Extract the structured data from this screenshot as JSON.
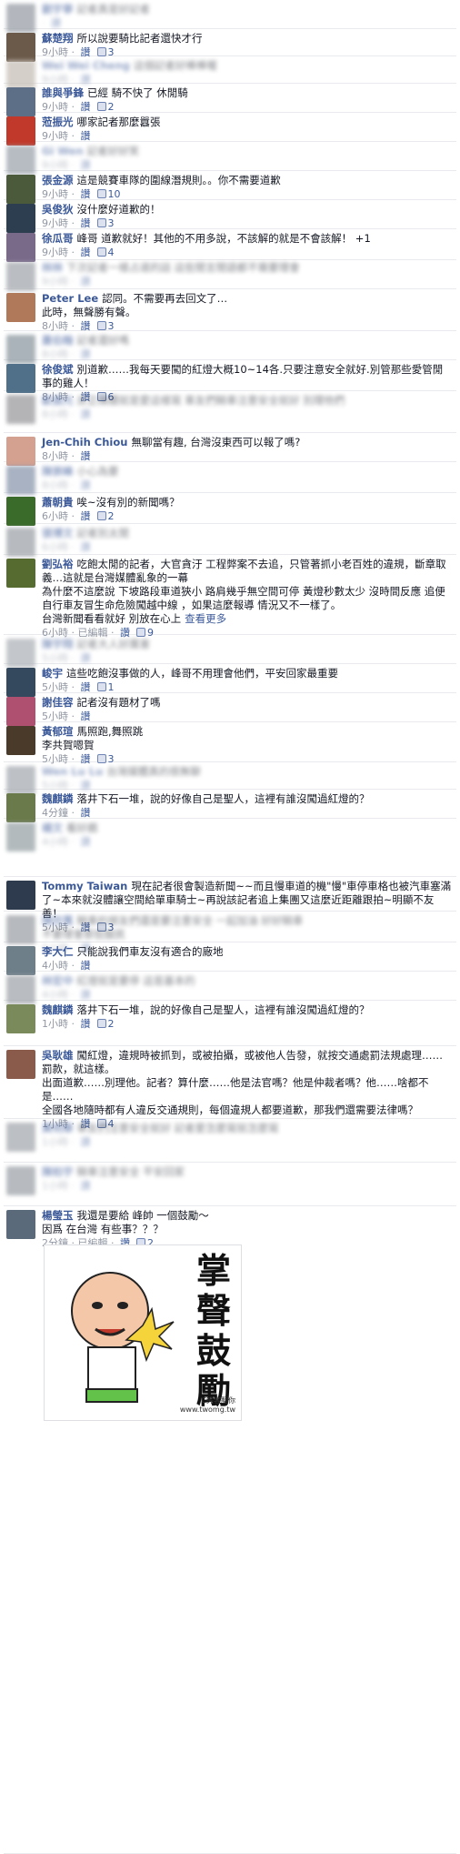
{
  "labels": {
    "reply": "讚",
    "edited": "已編輯",
    "see_more": "查看更多"
  },
  "colors": {
    "link": "#3b5998",
    "meta": "#9197a3",
    "divider": "#e9eaed"
  },
  "comments": [
    {
      "blur": true,
      "name": "劉宇寧",
      "text": "記者真是好記者",
      "time": "",
      "likes": ""
    },
    {
      "blur": false,
      "name": "蘇楚翔",
      "text": "所以說要騎比記者還快才行",
      "time": "9小時",
      "likes": "3"
    },
    {
      "blur": true,
      "name": "Wei Wei Cheng",
      "text": "這個記者好棒棒喔",
      "time": "9小時",
      "likes": ""
    },
    {
      "blur": false,
      "name": "誰與爭鋒",
      "text": "已經 騎不快了 休閒騎",
      "time": "9小時",
      "likes": "2"
    },
    {
      "blur": false,
      "name": "蒞振光",
      "text": "哪家記者那麼囂張",
      "time": "9小時",
      "likes": ""
    },
    {
      "blur": true,
      "name": "Gi Wen",
      "text": "記者好好笑",
      "time": "9小時",
      "likes": ""
    },
    {
      "blur": false,
      "name": "張金源",
      "text": "這是競賽車隊的圍線潛規則。。你不需要道歉",
      "time": "9小時",
      "likes": "10"
    },
    {
      "blur": false,
      "name": "吳俊狄",
      "text": "沒什麼好道歉的！",
      "time": "9小時",
      "likes": "3"
    },
    {
      "blur": false,
      "name": "徐瓜哥",
      "text": "峰哥 道歉就好！其他的不用多說，不該解的就是不會該解！ +1",
      "time": "9小時",
      "likes": "4"
    },
    {
      "blur": true,
      "name": "林林",
      "text": "下次記者一樣占道的話 這些閒言閒語都不需要理會",
      "time": "9小時",
      "likes": ""
    },
    {
      "blur": false,
      "name": "Peter Lee",
      "text": "認同。不需要再去回文了…\n此時，無聲勝有聲。",
      "time": "8小時",
      "likes": "3"
    },
    {
      "blur": true,
      "name": "蕭伯翰",
      "text": "記者還好嗎",
      "time": "8小時",
      "likes": ""
    },
    {
      "blur": false,
      "name": "徐俊斌",
      "text": "別道歉……我每天要闖的紅燈大概10~14各.只要注意安全就好.別管那些愛管閒事的雞人！",
      "time": "8小時",
      "likes": "6"
    },
    {
      "blur": true,
      "name": "歐振光",
      "text": "反正媒體就是愛這樣寫 車友們騎車注意安全就好 別理他們",
      "time": "8小時",
      "likes": ""
    },
    {
      "blur": false,
      "name": "Jen-Chih Chiou",
      "text": "無聊當有趣, 台灣沒東西可以報了嗎?",
      "time": "8小時",
      "likes": ""
    },
    {
      "blur": true,
      "name": "陳崇峰",
      "text": "小心為要",
      "time": "8小時",
      "likes": ""
    },
    {
      "blur": false,
      "name": "蕭朝貴",
      "text": "唉~沒有別的新聞嗎？",
      "time": "6小時",
      "likes": "2"
    },
    {
      "blur": true,
      "name": "張博文",
      "text": "記者別太閒",
      "time": "6小時",
      "likes": ""
    },
    {
      "blur": false,
      "name": "劉弘裕",
      "text": "吃飽太閒的記者，大官貪汙 工程弊案不去追，只管著抓小老百姓的違規，斷章取義…這就是台灣媒體亂象的一幕\n為什麼不這麼說 下坡路段車道狹小 路肩幾乎無空間可停 黃燈秒數太少 沒時間反應 追便自行車友冒生命危險闖越中線 ，如果這麼報導 情況又不一樣了。\n台灣新聞看看就好 別放在心上",
      "time": "6小時",
      "likes": "9",
      "edited": true,
      "more": true
    },
    {
      "blur": true,
      "name": "陳宇翔",
      "text": "記者大人好厲害",
      "time": "5小時",
      "likes": ""
    },
    {
      "blur": false,
      "name": "峻宇",
      "text": "這些吃飽沒事做的人，峰哥不用理會他們，平安回家最重要",
      "time": "5小時",
      "likes": "1"
    },
    {
      "blur": false,
      "name": "謝佳容",
      "text": "記者沒有題材了嗎",
      "time": "5小時",
      "likes": ""
    },
    {
      "blur": false,
      "name": "黃郁瑄",
      "text": "馬照跑,舞照跳\n李共賀嗯賀",
      "time": "5小時",
      "likes": "3"
    },
    {
      "blur": true,
      "name": "Wen Lu Lu",
      "text": "台灣媒體真的很無聊",
      "time": "5小時",
      "likes": ""
    },
    {
      "blur": false,
      "name": "魏麒鏻",
      "text": "落井下石一堆，說的好像自己是聖人，這裡有誰沒闖過紅燈的？",
      "time": "4分鐘",
      "likes": ""
    },
    {
      "blur": true,
      "name": "楊文",
      "text": "看好戲",
      "time": "4小時",
      "likes": ""
    },
    {
      "blur": false,
      "name": "Tommy Taiwan",
      "text": "現在記者很會製造新聞~~而且慢車道的機\"慢\"車停車格也被汽車塞滿了~本來就沒體讓空間給單車騎士~再說該記者追上集團又這麼近距離跟拍~明顯不友善！",
      "time": "5小時",
      "likes": "3"
    },
    {
      "blur": true,
      "name": "陳欣萬",
      "text": "騎車的朋友們還是要注意安全 一起加油 好好騎車\n不要理會那些酸民",
      "time": "5小時",
      "likes": ""
    },
    {
      "blur": false,
      "name": "李大仁",
      "text": "只能說我們車友沒有適合的廠地",
      "time": "4小時",
      "likes": ""
    },
    {
      "blur": true,
      "name": "林宏中",
      "text": "紅燈就是要停 這是基本的",
      "time": "4小時",
      "likes": ""
    },
    {
      "blur": false,
      "name": "魏麒鏻",
      "text": "落井下石一堆，說的好像自己是聖人，這裡有誰沒闖過紅燈的？",
      "time": "1小時",
      "likes": "2"
    },
    {
      "blur": false,
      "name": "吳耿雄",
      "text": "闖紅燈，違規時被抓到，或被拍攝，或被他人告發，就按交通處罰法規處理……罰款，就這樣。\n出面道歉……別理他。記者？算什麼……他是法官嗎？他是仲裁者嗎？他……啥都不是……\n全國各地隨時都有人違反交通規則，每個違規人都要道歉，那我們還需要法律嗎？",
      "time": "1小時",
      "likes": "4"
    },
    {
      "blur": true,
      "name": "黃明華",
      "text": "車友們注意安全就好 記者愛怎麼寫就怎麼寫",
      "time": "1小時",
      "likes": ""
    },
    {
      "blur": true,
      "name": "陳柏宇",
      "text": "騎車注意安全 平安回家",
      "time": "1小時",
      "likes": ""
    },
    {
      "blur": false,
      "name": "楊瑩玉",
      "text": "我還是要給 峰帥 一個鼓勵～\n因爲 在台灣 有些事？？？",
      "time": "2分鐘",
      "likes": "2",
      "edited": true
    }
  ],
  "sticker": {
    "caption": "掌聲鼓勵",
    "watermark": "C笑客翻你\nwww.twomg.tw"
  }
}
